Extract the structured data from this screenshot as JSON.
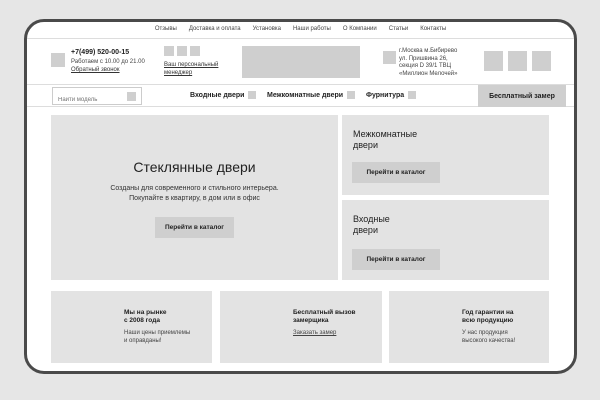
{
  "topnav": [
    "Отзывы",
    "Доставка и оплата",
    "Установка",
    "Наши работы",
    "О Компании",
    "Статьи",
    "Контакты"
  ],
  "header": {
    "phone": "+7(499) 520-00-15",
    "hours": "Работаем с 10.00 до 21.00",
    "callback": "Обратный звонок",
    "manager_line1": "Ваш персональный",
    "manager_line2": "менеджер",
    "address_lines": [
      "г.Москва м.Бибирево",
      "ул. Пришвина 26,",
      "секция D 39/1 ТВЦ",
      "«Миллион Мелочей»"
    ]
  },
  "search": {
    "placeholder": "Найти модель"
  },
  "menu": {
    "entrance": "Входные двери",
    "interior": "Межкомнатные двери",
    "hardware": "Фурнитура",
    "free_measure": "Бесплатный замер"
  },
  "hero": {
    "title": "Стеклянные двери",
    "line1": "Созданы для современного и стильного интерьера.",
    "line2": "Покупайте в квартиру, в дом или в офис",
    "button": "Перейти в каталог"
  },
  "side_panels": [
    {
      "title_line1": "Межкомнатные",
      "title_line2": "двери",
      "button": "Перейти в каталог"
    },
    {
      "title_line1": "Входные",
      "title_line2": "двери",
      "button": "Перейти в каталог"
    }
  ],
  "cards": [
    {
      "title_line1": "Мы на рынке",
      "title_line2": "с 2008 года",
      "desc_line1": "Наши цены приемлемы",
      "desc_line2": "и оправданы!"
    },
    {
      "title_line1": "Бесплатный вызов",
      "title_line2": "замерщика",
      "link": "Заказать замер"
    },
    {
      "title_line1": "Год гарантии на",
      "title_line2": "всю продукцию",
      "desc_line1": "У нас продукция",
      "desc_line2": "высокого качества!"
    }
  ]
}
